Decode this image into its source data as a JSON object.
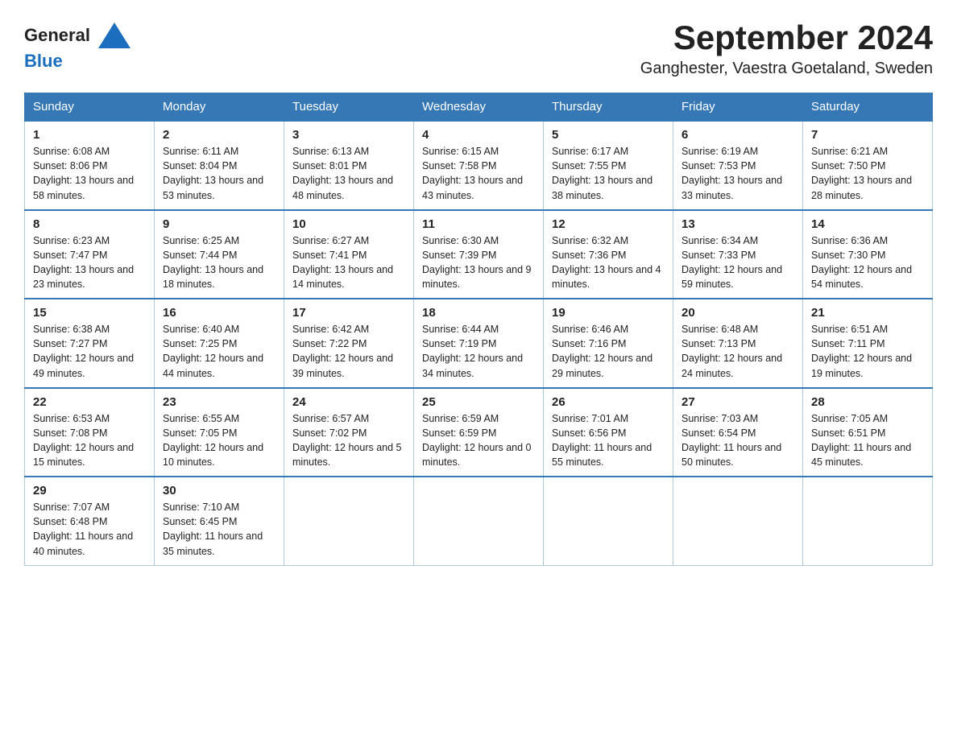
{
  "header": {
    "logo_general": "General",
    "logo_blue": "Blue",
    "title": "September 2024",
    "subtitle": "Ganghester, Vaestra Goetaland, Sweden"
  },
  "calendar": {
    "weekdays": [
      "Sunday",
      "Monday",
      "Tuesday",
      "Wednesday",
      "Thursday",
      "Friday",
      "Saturday"
    ],
    "weeks": [
      [
        {
          "day": "1",
          "sunrise": "Sunrise: 6:08 AM",
          "sunset": "Sunset: 8:06 PM",
          "daylight": "Daylight: 13 hours and 58 minutes."
        },
        {
          "day": "2",
          "sunrise": "Sunrise: 6:11 AM",
          "sunset": "Sunset: 8:04 PM",
          "daylight": "Daylight: 13 hours and 53 minutes."
        },
        {
          "day": "3",
          "sunrise": "Sunrise: 6:13 AM",
          "sunset": "Sunset: 8:01 PM",
          "daylight": "Daylight: 13 hours and 48 minutes."
        },
        {
          "day": "4",
          "sunrise": "Sunrise: 6:15 AM",
          "sunset": "Sunset: 7:58 PM",
          "daylight": "Daylight: 13 hours and 43 minutes."
        },
        {
          "day": "5",
          "sunrise": "Sunrise: 6:17 AM",
          "sunset": "Sunset: 7:55 PM",
          "daylight": "Daylight: 13 hours and 38 minutes."
        },
        {
          "day": "6",
          "sunrise": "Sunrise: 6:19 AM",
          "sunset": "Sunset: 7:53 PM",
          "daylight": "Daylight: 13 hours and 33 minutes."
        },
        {
          "day": "7",
          "sunrise": "Sunrise: 6:21 AM",
          "sunset": "Sunset: 7:50 PM",
          "daylight": "Daylight: 13 hours and 28 minutes."
        }
      ],
      [
        {
          "day": "8",
          "sunrise": "Sunrise: 6:23 AM",
          "sunset": "Sunset: 7:47 PM",
          "daylight": "Daylight: 13 hours and 23 minutes."
        },
        {
          "day": "9",
          "sunrise": "Sunrise: 6:25 AM",
          "sunset": "Sunset: 7:44 PM",
          "daylight": "Daylight: 13 hours and 18 minutes."
        },
        {
          "day": "10",
          "sunrise": "Sunrise: 6:27 AM",
          "sunset": "Sunset: 7:41 PM",
          "daylight": "Daylight: 13 hours and 14 minutes."
        },
        {
          "day": "11",
          "sunrise": "Sunrise: 6:30 AM",
          "sunset": "Sunset: 7:39 PM",
          "daylight": "Daylight: 13 hours and 9 minutes."
        },
        {
          "day": "12",
          "sunrise": "Sunrise: 6:32 AM",
          "sunset": "Sunset: 7:36 PM",
          "daylight": "Daylight: 13 hours and 4 minutes."
        },
        {
          "day": "13",
          "sunrise": "Sunrise: 6:34 AM",
          "sunset": "Sunset: 7:33 PM",
          "daylight": "Daylight: 12 hours and 59 minutes."
        },
        {
          "day": "14",
          "sunrise": "Sunrise: 6:36 AM",
          "sunset": "Sunset: 7:30 PM",
          "daylight": "Daylight: 12 hours and 54 minutes."
        }
      ],
      [
        {
          "day": "15",
          "sunrise": "Sunrise: 6:38 AM",
          "sunset": "Sunset: 7:27 PM",
          "daylight": "Daylight: 12 hours and 49 minutes."
        },
        {
          "day": "16",
          "sunrise": "Sunrise: 6:40 AM",
          "sunset": "Sunset: 7:25 PM",
          "daylight": "Daylight: 12 hours and 44 minutes."
        },
        {
          "day": "17",
          "sunrise": "Sunrise: 6:42 AM",
          "sunset": "Sunset: 7:22 PM",
          "daylight": "Daylight: 12 hours and 39 minutes."
        },
        {
          "day": "18",
          "sunrise": "Sunrise: 6:44 AM",
          "sunset": "Sunset: 7:19 PM",
          "daylight": "Daylight: 12 hours and 34 minutes."
        },
        {
          "day": "19",
          "sunrise": "Sunrise: 6:46 AM",
          "sunset": "Sunset: 7:16 PM",
          "daylight": "Daylight: 12 hours and 29 minutes."
        },
        {
          "day": "20",
          "sunrise": "Sunrise: 6:48 AM",
          "sunset": "Sunset: 7:13 PM",
          "daylight": "Daylight: 12 hours and 24 minutes."
        },
        {
          "day": "21",
          "sunrise": "Sunrise: 6:51 AM",
          "sunset": "Sunset: 7:11 PM",
          "daylight": "Daylight: 12 hours and 19 minutes."
        }
      ],
      [
        {
          "day": "22",
          "sunrise": "Sunrise: 6:53 AM",
          "sunset": "Sunset: 7:08 PM",
          "daylight": "Daylight: 12 hours and 15 minutes."
        },
        {
          "day": "23",
          "sunrise": "Sunrise: 6:55 AM",
          "sunset": "Sunset: 7:05 PM",
          "daylight": "Daylight: 12 hours and 10 minutes."
        },
        {
          "day": "24",
          "sunrise": "Sunrise: 6:57 AM",
          "sunset": "Sunset: 7:02 PM",
          "daylight": "Daylight: 12 hours and 5 minutes."
        },
        {
          "day": "25",
          "sunrise": "Sunrise: 6:59 AM",
          "sunset": "Sunset: 6:59 PM",
          "daylight": "Daylight: 12 hours and 0 minutes."
        },
        {
          "day": "26",
          "sunrise": "Sunrise: 7:01 AM",
          "sunset": "Sunset: 6:56 PM",
          "daylight": "Daylight: 11 hours and 55 minutes."
        },
        {
          "day": "27",
          "sunrise": "Sunrise: 7:03 AM",
          "sunset": "Sunset: 6:54 PM",
          "daylight": "Daylight: 11 hours and 50 minutes."
        },
        {
          "day": "28",
          "sunrise": "Sunrise: 7:05 AM",
          "sunset": "Sunset: 6:51 PM",
          "daylight": "Daylight: 11 hours and 45 minutes."
        }
      ],
      [
        {
          "day": "29",
          "sunrise": "Sunrise: 7:07 AM",
          "sunset": "Sunset: 6:48 PM",
          "daylight": "Daylight: 11 hours and 40 minutes."
        },
        {
          "day": "30",
          "sunrise": "Sunrise: 7:10 AM",
          "sunset": "Sunset: 6:45 PM",
          "daylight": "Daylight: 11 hours and 35 minutes."
        },
        {
          "day": "",
          "sunrise": "",
          "sunset": "",
          "daylight": ""
        },
        {
          "day": "",
          "sunrise": "",
          "sunset": "",
          "daylight": ""
        },
        {
          "day": "",
          "sunrise": "",
          "sunset": "",
          "daylight": ""
        },
        {
          "day": "",
          "sunrise": "",
          "sunset": "",
          "daylight": ""
        },
        {
          "day": "",
          "sunrise": "",
          "sunset": "",
          "daylight": ""
        }
      ]
    ]
  }
}
